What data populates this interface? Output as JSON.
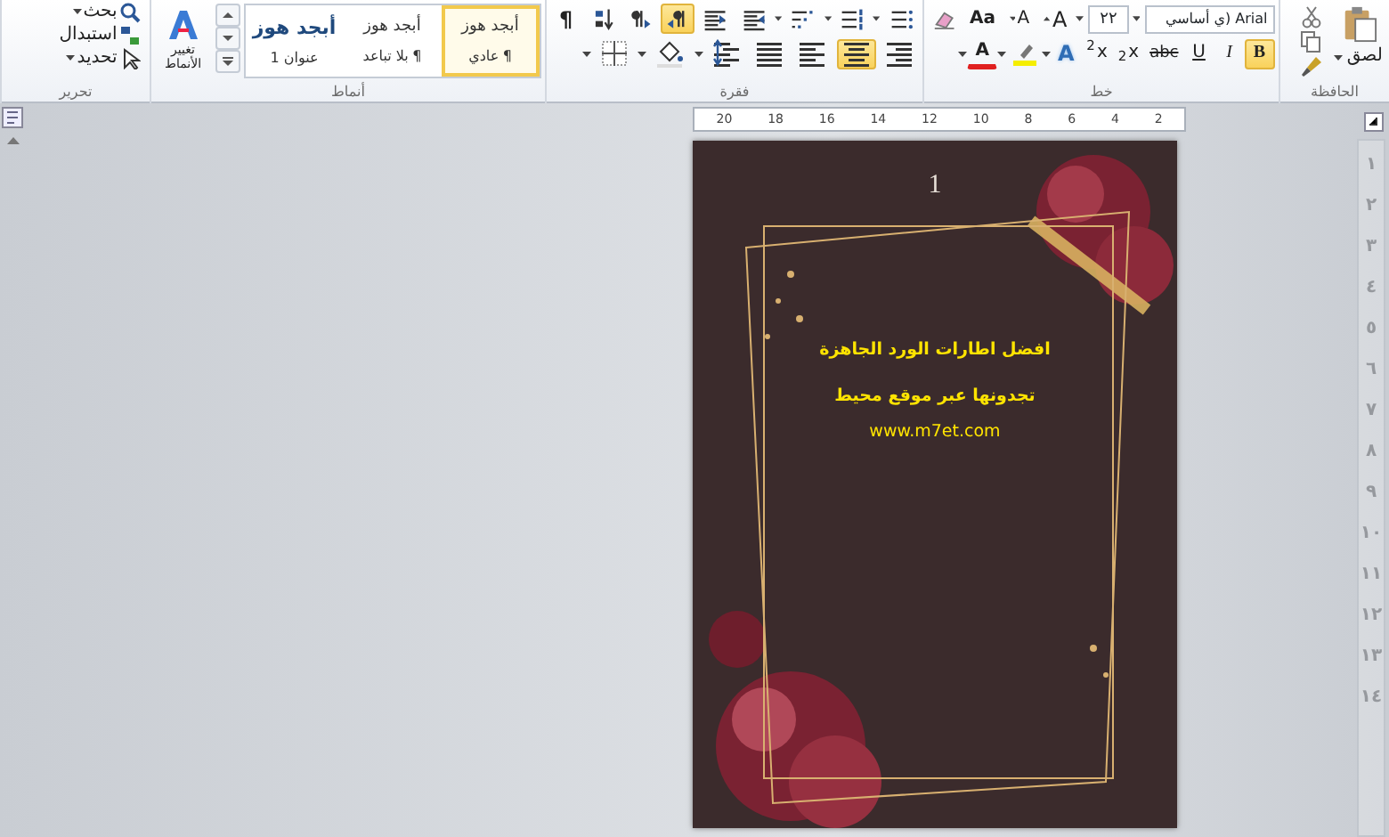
{
  "clipboard": {
    "paste_label": "لصق",
    "group_label": "الحافظة"
  },
  "font": {
    "font_name": "Arial (ي أساسي",
    "font_size": "٢٢",
    "grow_label": "A",
    "shrink_label": "A",
    "case_label": "Aa",
    "row2": [
      {
        "kind": "bold",
        "label": "B",
        "selected": true
      },
      {
        "kind": "italic",
        "label": "I",
        "selected": false
      },
      {
        "kind": "underline",
        "label": "U",
        "selected": false
      },
      {
        "kind": "strike",
        "label": "abc",
        "selected": false
      },
      {
        "kind": "text",
        "label": "x$_{2}$",
        "selected": false
      },
      {
        "kind": "text",
        "label": "x$^{2}$",
        "selected": false
      },
      {
        "kind": "effects",
        "label": "A",
        "selected": false
      },
      {
        "kind": "highlight",
        "selected": false
      },
      {
        "kind": "color",
        "label": "A",
        "selected": false
      }
    ],
    "group_label": "خط"
  },
  "paragraph": {
    "row1": [
      {
        "kind": "bullets",
        "selected": false
      },
      {
        "kind": "numbering",
        "selected": false
      },
      {
        "kind": "multilevel",
        "selected": false
      },
      {
        "kind": "outdent",
        "selected": false
      },
      {
        "kind": "indent",
        "selected": false
      },
      {
        "kind": "rtl",
        "selected": true
      },
      {
        "kind": "ltr",
        "selected": false
      },
      {
        "kind": "sort",
        "selected": false
      },
      {
        "kind": "pilcrow",
        "label": "¶",
        "selected": false
      }
    ],
    "row2": [
      {
        "kind": "align_right",
        "selected": false
      },
      {
        "kind": "center",
        "selected": true
      },
      {
        "kind": "align_left",
        "selected": false
      },
      {
        "kind": "justify",
        "selected": false
      },
      {
        "kind": "spacing",
        "selected": false
      },
      {
        "kind": "shading",
        "selected": false
      },
      {
        "kind": "borders",
        "selected": false
      }
    ],
    "group_label": "فقرة"
  },
  "styles": {
    "gallery": [
      {
        "kind": "normal",
        "sample": "أبجد هوز",
        "marker": "¶",
        "name": "عادي",
        "selected": true
      },
      {
        "kind": "normal",
        "sample": "أبجد هوز",
        "marker": "¶",
        "name": "بلا تباعد",
        "selected": false
      },
      {
        "kind": "heading",
        "sample": "أبجد هوز",
        "name": "عنوان 1",
        "selected": false
      }
    ],
    "change_styles": "تغيير الأنماط",
    "group_label": "أنماط"
  },
  "editing": {
    "items": [
      {
        "kind": "menu",
        "label": "بحث"
      },
      {
        "kind": "plain",
        "label": "استبدال"
      },
      {
        "kind": "menu",
        "label": "تحديد"
      }
    ],
    "group_label": "تحرير"
  },
  "horizontal_ruler": [
    "2",
    "4",
    "6",
    "8",
    "10",
    "12",
    "14",
    "16",
    "18",
    "20"
  ],
  "vertical_ruler": [
    "١",
    "٢",
    "٣",
    "٤",
    "٥",
    "٦",
    "٧",
    "٨",
    "٩",
    "١٠",
    "١١",
    "١٢",
    "١٣",
    "١٤"
  ],
  "document": {
    "page_number": "1",
    "title": "افضل اطارات الورد الجاهزة",
    "subtitle": "تجدونها عبر موقع محيط",
    "url": "www.m7et.com"
  }
}
